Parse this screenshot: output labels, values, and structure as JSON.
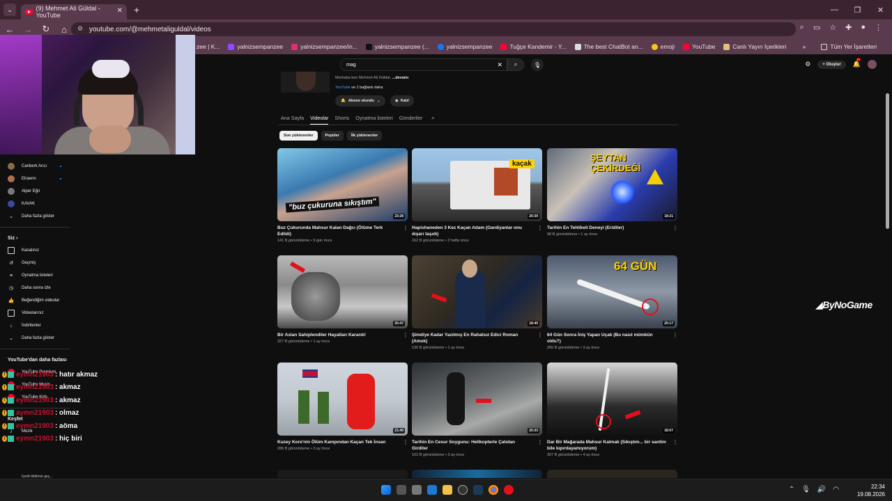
{
  "browser": {
    "tab_title": "(9) Mehmet Ali Güldal - YouTube",
    "url": "youtube.com/@mehmetaliguldal/videos",
    "bookmarks": [
      {
        "label": "zee | K...",
        "color": "#cc3333"
      },
      {
        "label": "yalnizsempanzee",
        "color": "#9146ff"
      },
      {
        "label": "yalnizsempanzee/in...",
        "color": "#e1306c"
      },
      {
        "label": "yalnizsempanzee (...",
        "color": "#222222"
      },
      {
        "label": "yalnizsempanzee",
        "color": "#1877f2"
      },
      {
        "label": "Tuğçe Kandemir - Y...",
        "color": "#ff0033"
      },
      {
        "label": "The best ChatBot an...",
        "color": "#dddddd"
      },
      {
        "label": "emoji",
        "color": "#f5c518"
      },
      {
        "label": "YouTube",
        "color": "#ff0033"
      },
      {
        "label": "Canlı Yayın İçerikleri",
        "color": "#e0c080"
      }
    ],
    "all_bookmarks": "Tüm Yer İşaretleri"
  },
  "yt": {
    "search_value": "mag",
    "create_label": "Oluştur",
    "notif_count": "9+",
    "channel": {
      "desc_prefix": "Merhaba ben Mehmet Ali Güldal, ",
      "desc_more": "...devamı",
      "link_text": "YouTube",
      "link_suffix": " ve 1 bağlantı daha",
      "subscribed_label": "Abone olundu",
      "join_label": "Katıl"
    },
    "tabs": [
      "Ana Sayfa",
      "Videolar",
      "Shorts",
      "Oynatma listeleri",
      "Gönderiler"
    ],
    "chips": [
      "Son yüklenenler",
      "Popüler",
      "İlk yüklenenler"
    ],
    "sidebar": {
      "subs": [
        {
          "label": "Canberk Arıcı",
          "color": "#8a6a4a"
        },
        {
          "label": "Elraenn",
          "color": "#b07050"
        },
        {
          "label": "Alper Eğri",
          "color": "#7a7a7a"
        },
        {
          "label": "KAVAK",
          "color": "#3a4aa0"
        }
      ],
      "show_more": "Daha fazla göster",
      "you_head": "Siz",
      "you_items": [
        {
          "label": "Kanalınız",
          "icon": "▢"
        },
        {
          "label": "Geçmiş",
          "icon": "↺"
        },
        {
          "label": "Oynatma listeleri",
          "icon": "≡"
        },
        {
          "label": "Daha sonra izle",
          "icon": "◷"
        },
        {
          "label": "Beğendiğim videolar",
          "icon": "👍"
        },
        {
          "label": "Videolarınız",
          "icon": "▶"
        },
        {
          "label": "İndirilenler",
          "icon": "↓"
        }
      ],
      "show_more2": "Daha fazla göster",
      "more_head": "YouTube'dan daha fazlası",
      "more_items": [
        "YouTube Premium",
        "YouTube Music",
        "YouTube Kids"
      ],
      "explore_head": "Keşfet",
      "explore_items": [
        "Müzik",
        "İçerik bildirme geç..."
      ]
    },
    "videos": [
      {
        "title": "Buz Çukurunda Mahsur Kalan Dağcı (Ölüme Terk Edildi)",
        "views": "141 B görüntüleme",
        "age": "9 gün önce",
        "duration": "23:28",
        "overlay": "\"buz çukuruna sıkıştım\""
      },
      {
        "title": "Hapishaneden 3 Kez Kaçan Adam (Gardiyanlar onu dışarı taşıdı)",
        "views": "162 B görüntüleme",
        "age": "2 hafta önce",
        "duration": "20:39",
        "overlay": "kaçak"
      },
      {
        "title": "Tarihin En Tehlikeli Deneyi (Eridiler)",
        "views": "98 B görüntüleme",
        "age": "1 ay önce",
        "duration": "18:21",
        "overlay": "ŞEYTAN ÇEKİRDEĞİ"
      },
      {
        "title": "Bir Aslan Sahiplendiler Hayatları Karardı!",
        "views": "327 B görüntüleme",
        "age": "1 ay önce",
        "duration": "20:47",
        "overlay": ""
      },
      {
        "title": "Şimdiye Kadar Yazılmış En Rahatsız Edici Roman (Amok)",
        "views": "130 B görüntüleme",
        "age": "1 ay önce",
        "duration": "18:40",
        "overlay": ""
      },
      {
        "title": "64 Gün Sonra İniş Yapan Uçak (Bu nasıl mümkün oldu?)",
        "views": "200 B görüntüleme",
        "age": "3 ay önce",
        "duration": "20:17",
        "overlay": "64 GÜN"
      },
      {
        "title": "Kuzey Kore'nin Ölüm Kampından Kaçan Tek İnsan",
        "views": "286 B görüntüleme",
        "age": "3 ay önce",
        "duration": "21:40",
        "overlay": ""
      },
      {
        "title": "Tarihin En Cesur Soygunu: Helikopterle Çatıdan Girdiler",
        "views": "162 B görüntüleme",
        "age": "3 ay önce",
        "duration": "20:33",
        "overlay": ""
      },
      {
        "title": "Dar Bir Mağarada Mahsur Kalmak (Sıkıştım... bir santim bile kıpırdayamıyorum)",
        "views": "307 B görüntüleme",
        "age": "4 ay önce",
        "duration": "18:07",
        "overlay": ""
      }
    ]
  },
  "overlay": {
    "brand": "ByNoGame",
    "chat": [
      {
        "user": "eymn21903",
        "msg": ": hatır akmaz"
      },
      {
        "user": "eymn21903",
        "msg": ": akmaz"
      },
      {
        "user": "eymn21903",
        "msg": ": akmaz"
      },
      {
        "user": "aymn21903",
        "msg": ": olmaz"
      },
      {
        "user": "eymn21903",
        "msg": ": aöma"
      },
      {
        "user": "eymn21903",
        "msg": ": hiç biri"
      }
    ]
  },
  "taskbar": {
    "time": "22:34",
    "date": "19.08.2026"
  }
}
